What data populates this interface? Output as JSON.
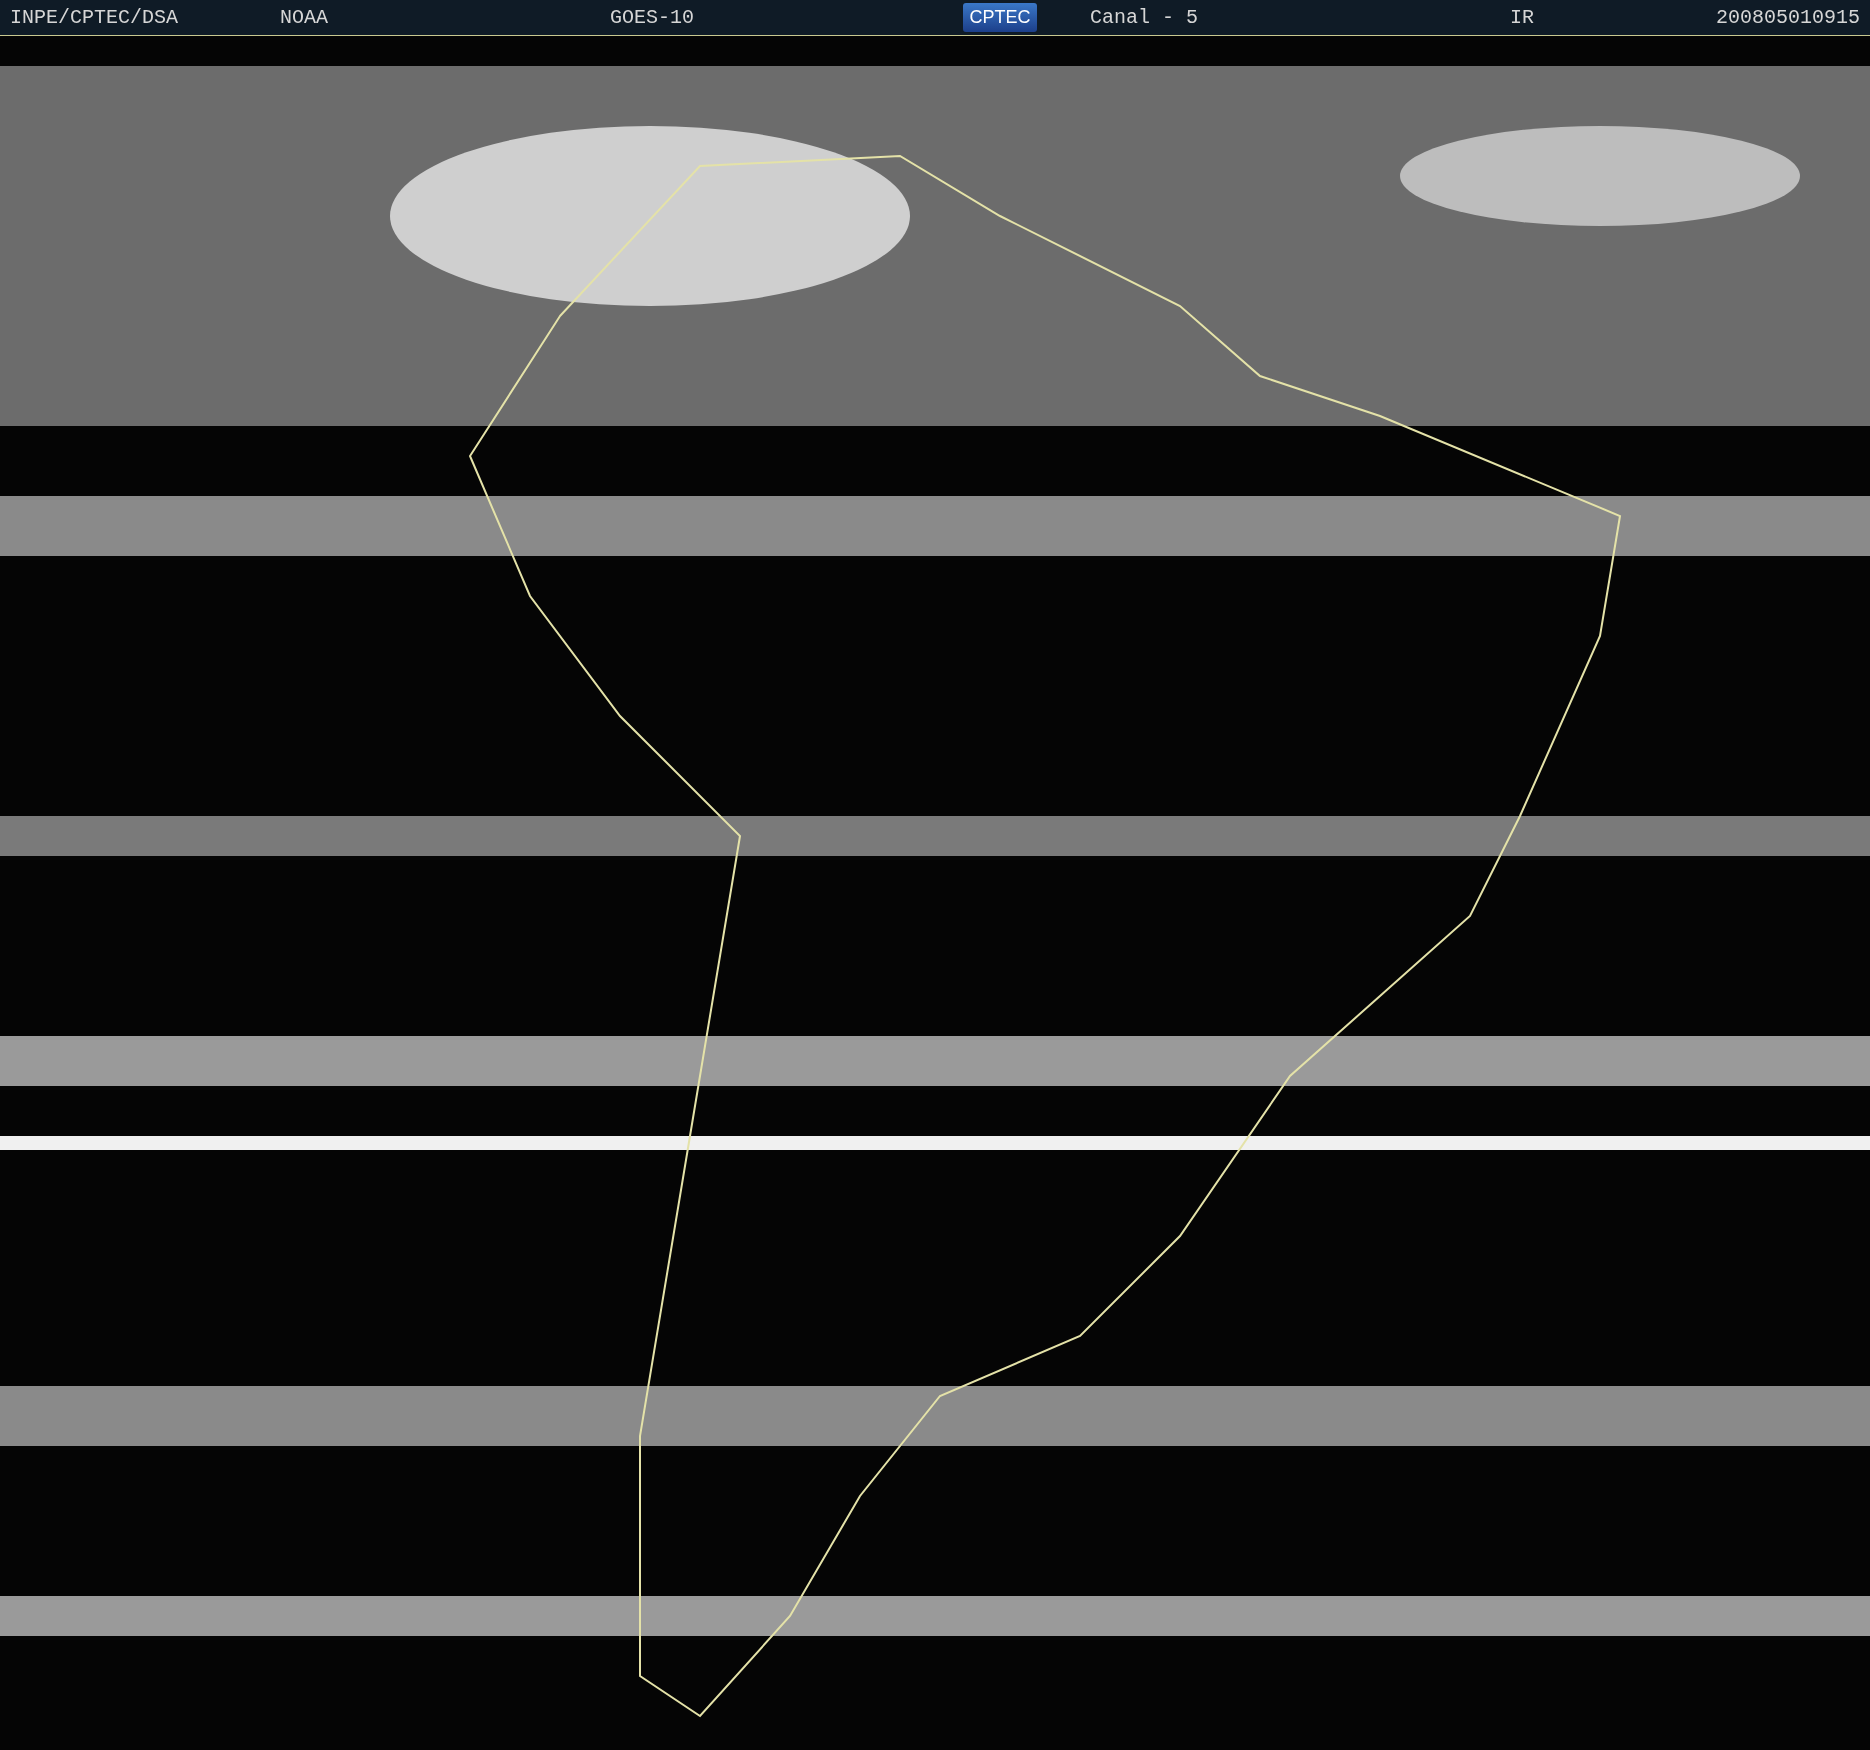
{
  "header": {
    "labels": [
      {
        "text": "INPE/CPTEC/DSA",
        "kind": "text"
      },
      {
        "text": "NOAA",
        "kind": "text"
      },
      {
        "text": "GOES-10",
        "kind": "text"
      },
      {
        "text": "CPTEC",
        "kind": "logo"
      },
      {
        "text": "Canal - 5",
        "kind": "text"
      },
      {
        "text": "IR",
        "kind": "text"
      },
      {
        "text": "200805010915",
        "kind": "text"
      }
    ]
  }
}
